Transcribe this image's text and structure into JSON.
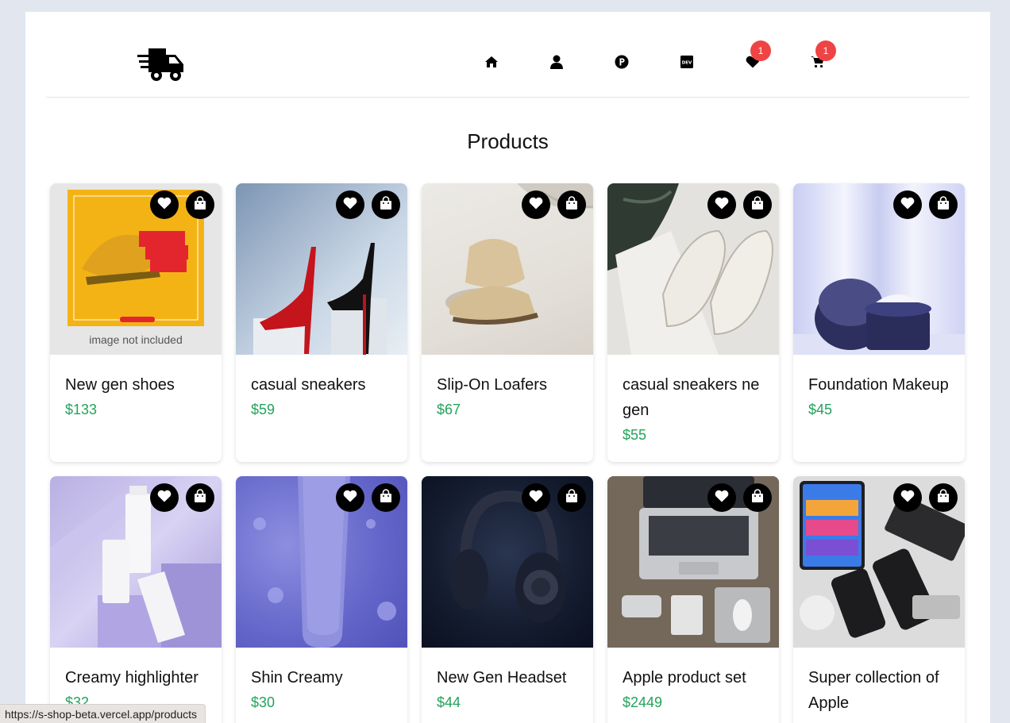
{
  "header": {
    "logo_icon": "delivery-truck-icon",
    "nav": [
      {
        "name": "home",
        "icon": "home-icon"
      },
      {
        "name": "profile",
        "icon": "user-icon"
      },
      {
        "name": "portfolio",
        "icon": "p-circle-icon"
      },
      {
        "name": "dev",
        "icon": "dev-icon"
      },
      {
        "name": "wishlist",
        "icon": "heart-icon",
        "badge": "1"
      },
      {
        "name": "cart",
        "icon": "cart-icon",
        "badge": "1"
      }
    ]
  },
  "page": {
    "title": "Products"
  },
  "products": [
    {
      "name": "New gen shoes",
      "price": "$133",
      "image_note": "image not included"
    },
    {
      "name": "casual sneakers",
      "price": "$59"
    },
    {
      "name": "Slip-On Loafers",
      "price": "$67"
    },
    {
      "name": "casual sneakers ne gen",
      "price": "$55"
    },
    {
      "name": "Foundation Makeup",
      "price": "$45"
    },
    {
      "name": "Creamy highlighter",
      "price": "$32"
    },
    {
      "name": "Shin Creamy",
      "price": "$30"
    },
    {
      "name": "New Gen Headset",
      "price": "$44"
    },
    {
      "name": "Apple product set",
      "price": "$2449"
    },
    {
      "name": "Super collection of Apple",
      "price": ""
    }
  ],
  "status_bar": {
    "url": "https://s-shop-beta.vercel.app/products"
  },
  "colors": {
    "price": "#22a35a",
    "badge": "#ef4444",
    "background": "#e2e7ef"
  }
}
